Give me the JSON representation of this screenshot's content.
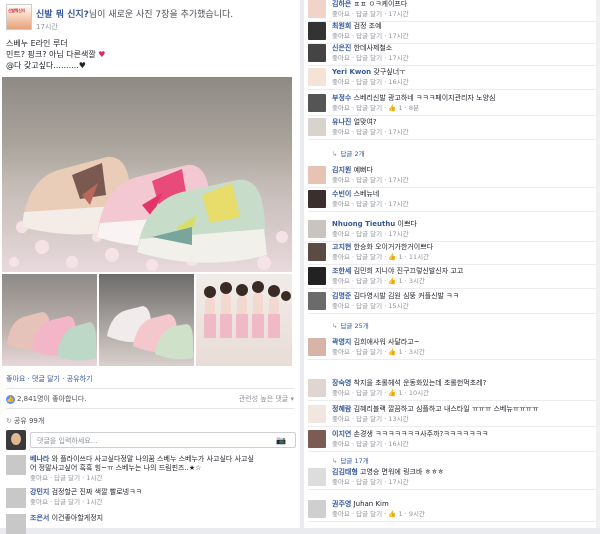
{
  "header": {
    "page_name": "신발 뭐 신지?",
    "action": "님이 새로운 사진 7장을 추가했습니다.",
    "time": "17시간",
    "avatar_text": "신발뭐신지"
  },
  "post": {
    "lines": [
      "스베누 E라인 루더",
      "민트? 핑크? 아님 다른색깔",
      "@다 갖고싶다..........♥"
    ],
    "heart": "♥"
  },
  "actions": {
    "like": "좋아요",
    "comment": "댓글 달기",
    "share": "공유하기",
    "dot": " · "
  },
  "stats": {
    "likes": "2,841명이 좋아합니다.",
    "sort": "관련성 높은 댓글",
    "shares": "공유 99개",
    "thumb": "👍",
    "share_icon": "↻"
  },
  "comment_box": {
    "placeholder": "댓글을 입력하세요...",
    "camera": "📷"
  },
  "left_comments": [
    {
      "name": "베나라",
      "text": "와 플라이쓰다 사고싶다정말 나의꿈 스베누 스베누가 사고싶다 사고싶",
      "text2": "어 정말사고싶어 흑흑 힝~ㅠ 스베누는 나의 드림핀즈..★☆",
      "meta": "좋아요 · 답글 달기 · 1시간"
    },
    {
      "name": "강민지",
      "text": "검정할곤 진짜 색깔 빨로넹ㅋㅋ",
      "meta": "좋아요 · 답글 달기 · 1시간"
    },
    {
      "name": "조은서",
      "text": "이건좋아할게정지",
      "meta": ""
    }
  ],
  "right_items": [
    {
      "kind": "comment",
      "name": "김하은",
      "text": "ㅍㅍ ㅇㅋ케이프다",
      "meta": "좋아요 · 답글 달기 · 17시간"
    },
    {
      "kind": "comment",
      "name": "최원희",
      "text": "검정 조예",
      "meta": "좋아요 · 답글 달기 · 17시간"
    },
    {
      "kind": "comment",
      "name": "신은진",
      "text": "한데사제철소",
      "meta": "좋아요 · 답글 달기 · 17시간"
    },
    {
      "kind": "comment",
      "name": "Yeri Kwon",
      "text": "갖구싶너ㅜ",
      "meta": "좋아요 · 답글 달기 · 16시간"
    },
    {
      "kind": "comment",
      "name": "부정수",
      "text": "스베리신발 광고하네 ㅋㅋㅋ페이지관리자 노양심",
      "meta": "좋아요 · 답글 달기 · 👍 1 · 8분"
    },
    {
      "kind": "comment",
      "name": "유나진",
      "text": "얼맞여?",
      "meta": "좋아요 · 답글 달기 · 17시간"
    },
    {
      "kind": "reply",
      "text": "답글 2개"
    },
    {
      "kind": "comment",
      "name": "김지원",
      "text": "예뻐다",
      "meta": "좋아요 · 답글 달기 · 17시간"
    },
    {
      "kind": "comment",
      "name": "수빈이",
      "text": "스베뉴네",
      "meta": "좋아요 · 답글 달기 · 17시간"
    },
    {
      "kind": "comment",
      "name": "Nhuong Tieuthu",
      "text": "이쁘다",
      "meta": "좋아요 · 답글 달기 · 17시간"
    },
    {
      "kind": "comment",
      "name": "고지현",
      "text": "한승화 오이거가한거이쁘다",
      "meta": "좋아요 · 답글 달기 · 👍 1 · 11시간"
    },
    {
      "kind": "comment",
      "name": "조한세",
      "text": "김민희 지니야 진구끄렇신발신자 고고",
      "meta": "좋아요 · 답글 달기 · 👍 1 · 3시간"
    },
    {
      "kind": "comment",
      "name": "김명준",
      "text": "김다영시발 김원 심뚱 커플신발 ㅋㅋ",
      "meta": "좋아요 · 답글 달기 · 15시간"
    },
    {
      "kind": "reply",
      "text": "답글 25개"
    },
    {
      "kind": "comment",
      "name": "곽영지",
      "text": "김희애사워 사달라고~",
      "meta": "좋아요 · 답글 달기 · 👍 1 · 3시간"
    },
    {
      "kind": "comment",
      "name": "장숙영",
      "text": "착지을 초롤헤석 운동화있는데 초롤헌먹초레?",
      "meta": "좋아요 · 답글 달기 · 👍 1 · 10시간"
    },
    {
      "kind": "comment",
      "name": "정혜람",
      "text": "김혜리블랙 깔끔하고 심플하고 내스타일 ㅠㅠㅠ 스베뉴ㅠㅠㅠㅠ",
      "meta": "좋아요 · 답글 달기 · 13시간"
    },
    {
      "kind": "comment",
      "name": "이지연",
      "text": "손경생 ㅋㅋㅋㅋㅋㅋㅋ사주까?ㅋㅋㅋㅋㅋㅋㅋ",
      "meta": "좋아요 · 답글 달기 · 16시간"
    },
    {
      "kind": "reply",
      "text": "답글 17개"
    },
    {
      "kind": "comment",
      "name": "김김태형",
      "text": "고영승 면워에 링크바 ㅎㅎㅎ",
      "meta": "좋아요 · 답글 달기 · 17시간"
    },
    {
      "kind": "comment",
      "name": "권주영",
      "text": "Juhan Kim",
      "meta": "좋아요 · 답글 달기 · 👍 1 · 9시간"
    }
  ],
  "colors": {
    "link": "#365899",
    "meta": "#90949c",
    "like_blue": "#5890ff"
  }
}
